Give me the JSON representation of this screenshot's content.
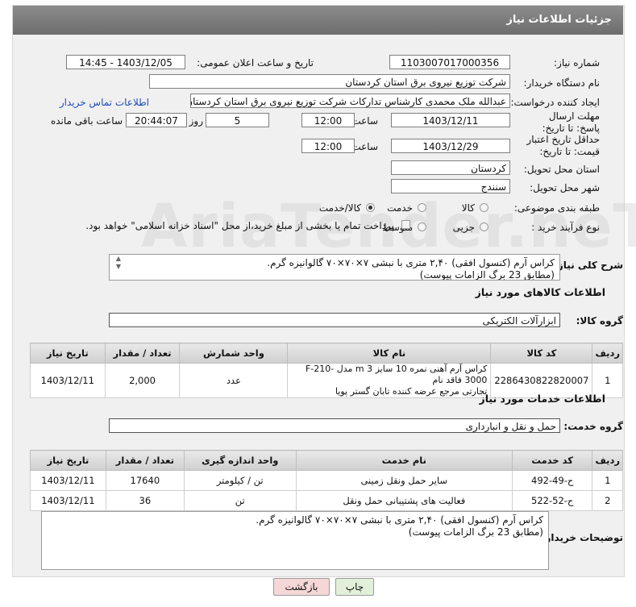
{
  "header": {
    "title": "جزئیات اطلاعات نیاز"
  },
  "fields": {
    "need_number_label": "شماره نیاز:",
    "need_number": "1103007017000356",
    "announce_label": "تاریخ و ساعت اعلان عمومی:",
    "announce_value": "1403/12/05 - 14:45",
    "buyer_label": "نام دستگاه خریدار:",
    "buyer_value": "شرکت توزیع نیروی برق استان کردستان",
    "creator_label": "ایجاد کننده درخواست:",
    "creator_value": "عبدالله ملک محمدی کارشناس تدارکات شرکت توزیع نیروی برق استان کردستان",
    "contact_link": "اطلاعات تماس خریدار",
    "deadline_label": "مهلت ارسال پاسخ: تا تاریخ:",
    "deadline_date": "1403/12/11",
    "time_word": "ساعت",
    "deadline_time": "12:00",
    "days_value": "5",
    "days_word": "روز و",
    "remaining_time": "20:44:07",
    "remaining_word": "ساعت باقی مانده",
    "validity_label": "حداقل تاریخ اعتبار قیمت: تا تاریخ:",
    "validity_date": "1403/12/29",
    "validity_time": "12:00",
    "province_label": "استان محل تحویل:",
    "province_value": "کردستان",
    "city_label": "شهر محل تحویل:",
    "city_value": "سنندج",
    "category_label": "طبقه بندی موضوعی:",
    "category_options": [
      "کالا",
      "خدمت",
      "کالا/خدمت"
    ],
    "process_label": "نوع فرآیند خرید :",
    "process_options": [
      "جزیی",
      "متوسط"
    ],
    "payment_note": "پرداخت تمام یا بخشی از مبلغ خرید،از محل \"اسناد خزانه اسلامی\" خواهد بود."
  },
  "summary": {
    "label": "شرح کلی نیاز:",
    "line1": "کراس آرم (کنسول افقی) ۲,۴۰ متری با نبشی ۷×۷۰×۷۰ گالوانیزه گرم.",
    "line2": "(مطابق 23 برگ الزامات پیوست)"
  },
  "goods": {
    "section_title": "اطلاعات کالاهای مورد نیاز",
    "group_label": "گروه کالا:",
    "group_value": "ابزارآلات الکتریکی",
    "columns": [
      "ردیف",
      "کد کالا",
      "نام کالا",
      "واحد شمارش",
      "تعداد / مقدار",
      "تاریخ نیاز"
    ],
    "rows": [
      {
        "row": "1",
        "code": "2286430822820007",
        "name_line1": "کراس آرم آهنی نمره 10 سایز 3 m مدل F-210-3000 فاقد نام",
        "name_line2": "تجارتی مرجع عرضه کننده تابان گستر پویا",
        "unit": "عدد",
        "qty": "2,000",
        "date": "1403/12/11"
      }
    ]
  },
  "services": {
    "section_title": "اطلاعات خدمات مورد نیاز",
    "group_label": "گروه خدمت:",
    "group_value": "حمل و نقل و انبارداری",
    "columns": [
      "ردیف",
      "کد خدمت",
      "نام خدمت",
      "واحد اندازه گیری",
      "تعداد / مقدار",
      "تاریخ نیاز"
    ],
    "rows": [
      {
        "row": "1",
        "code": "ح-49-492",
        "name": "سایر حمل ونقل زمینی",
        "unit": "تن / کیلومتر",
        "qty": "17640",
        "date": "1403/12/11"
      },
      {
        "row": "2",
        "code": "ح-52-522",
        "name": "فعالیت های پشتیبانی حمل ونقل",
        "unit": "تن",
        "qty": "36",
        "date": "1403/12/11"
      }
    ]
  },
  "buyer_notes": {
    "label": "توضیحات خریدار:",
    "line1": "کراس آرم (کنسول افقی) ۲,۴۰ متری با نبشی ۷×۷۰×۷۰ گالوانیزه گرم.",
    "line2": "(مطابق 23 برگ الزامات پیوست)"
  },
  "buttons": {
    "print": "چاپ",
    "back": "بازگشت"
  },
  "watermark": "AriaTender.neT",
  "colors": {
    "header_bg": "#7a7a7a",
    "link": "#1a4fb8",
    "back_btn_bg": "#f6d7d7",
    "print_btn_bg": "#e3f0d9"
  }
}
